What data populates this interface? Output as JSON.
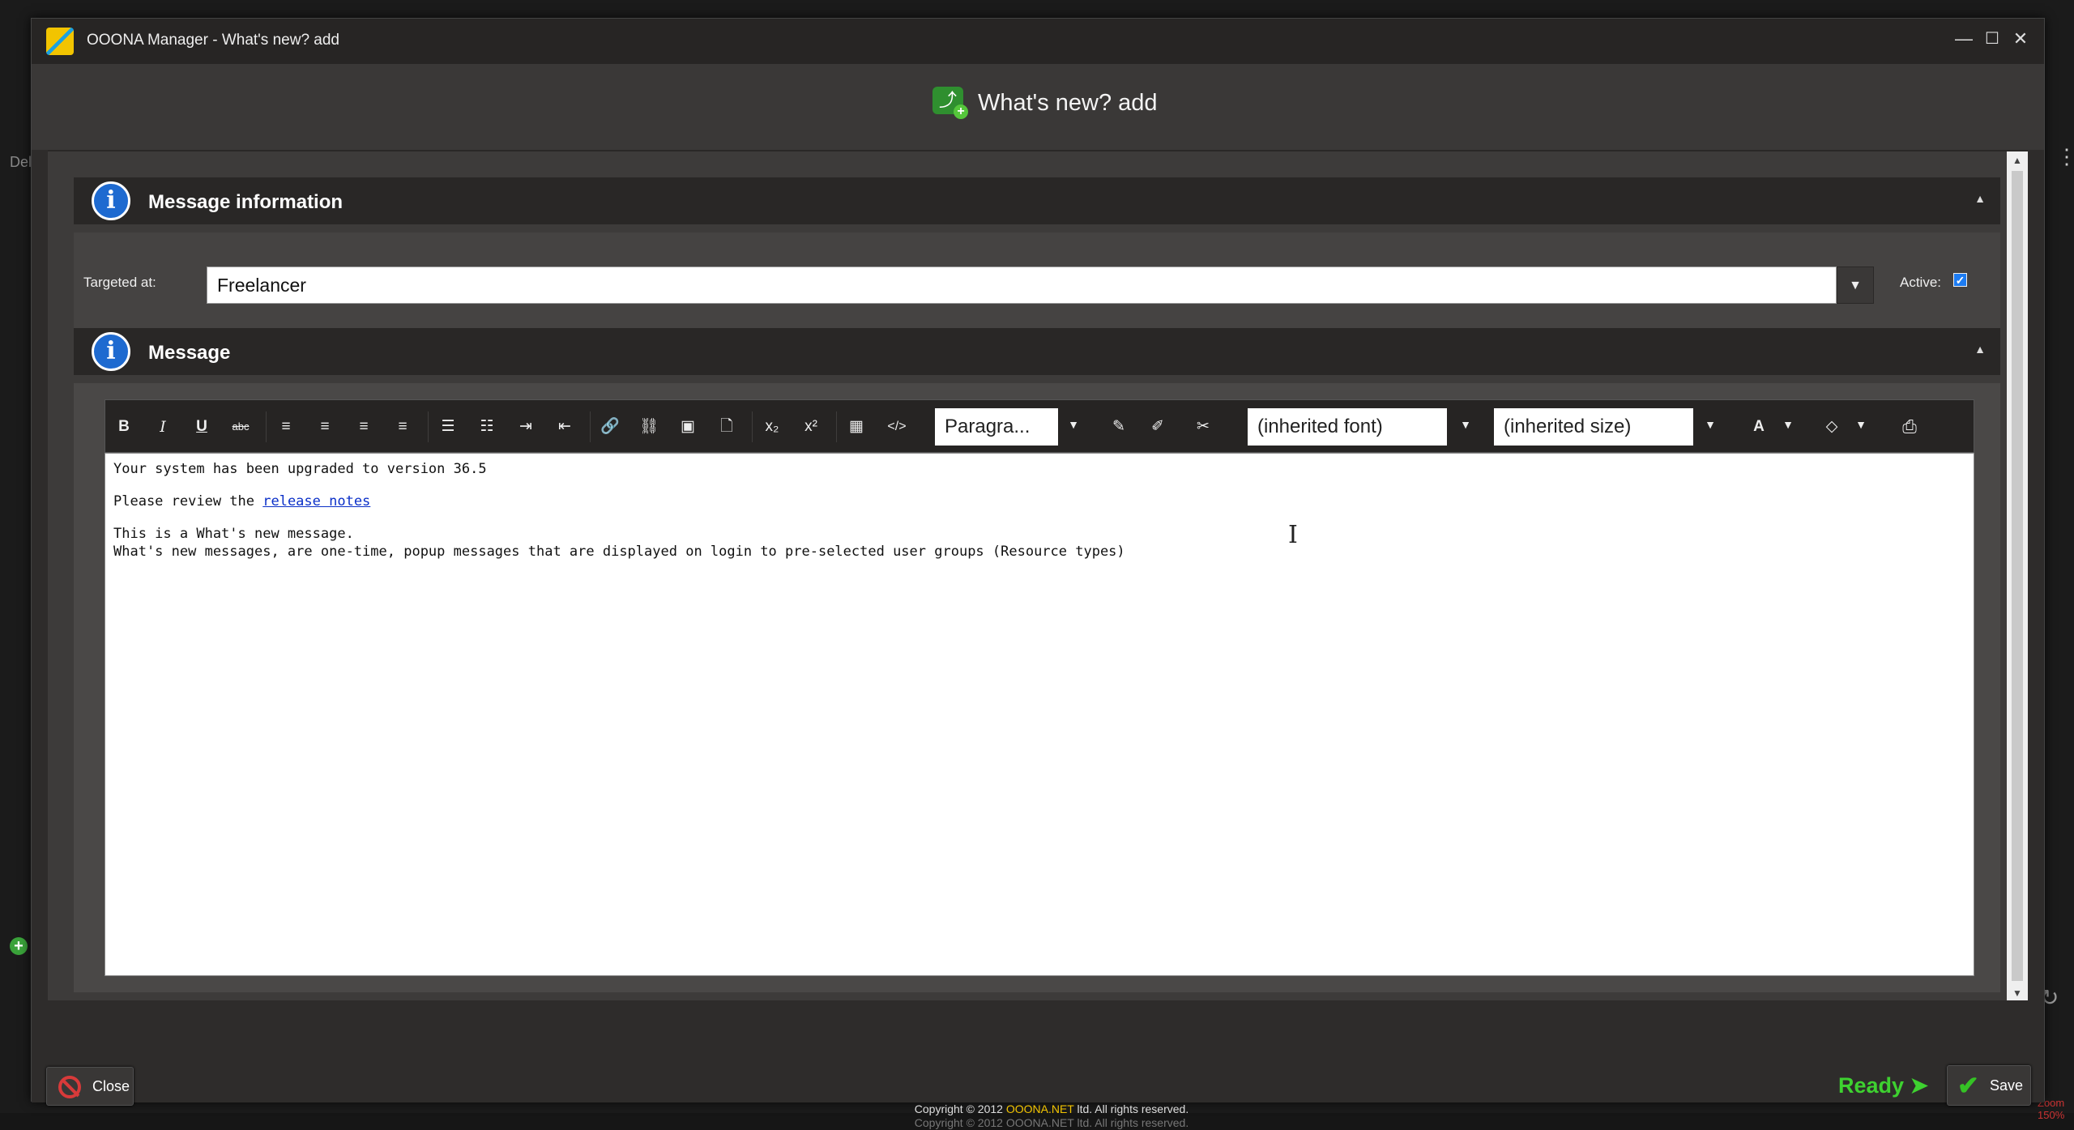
{
  "window": {
    "title": "OOONA Manager - What's new? add",
    "minimize_glyph": "—",
    "maximize_glyph": "☐",
    "close_glyph": "✕"
  },
  "background": {
    "left_label": "Del"
  },
  "header": {
    "title": "What's new? add",
    "icon": "share-add-icon"
  },
  "sections": {
    "message_info": {
      "title": "Message information",
      "icon": "info-icon"
    },
    "message": {
      "title": "Message",
      "icon": "info-icon"
    }
  },
  "form": {
    "targeted_label": "Targeted at:",
    "targeted_value": "Freelancer",
    "active_label": "Active:",
    "active_checked": true
  },
  "toolbar": {
    "buttons": [
      {
        "name": "bold-button",
        "glyph": "B"
      },
      {
        "name": "italic-button",
        "glyph": "I"
      },
      {
        "name": "underline-button",
        "glyph": "U"
      },
      {
        "name": "strikethrough-button",
        "glyph": "abc"
      },
      {
        "name": "align-left-button",
        "glyph": "≡"
      },
      {
        "name": "align-center-button",
        "glyph": "≡"
      },
      {
        "name": "align-right-button",
        "glyph": "≡"
      },
      {
        "name": "align-justify-button",
        "glyph": "≡"
      },
      {
        "name": "bullet-list-button",
        "glyph": "☰"
      },
      {
        "name": "numbered-list-button",
        "glyph": "☷"
      },
      {
        "name": "indent-button",
        "glyph": "⇥"
      },
      {
        "name": "outdent-button",
        "glyph": "⇤"
      },
      {
        "name": "insert-link-button",
        "glyph": "🔗"
      },
      {
        "name": "remove-link-button",
        "glyph": "⛓"
      },
      {
        "name": "insert-image-button",
        "glyph": "▣"
      },
      {
        "name": "insert-file-button",
        "glyph": "🗋"
      },
      {
        "name": "subscript-button",
        "glyph": "x₂"
      },
      {
        "name": "superscript-button",
        "glyph": "x²"
      },
      {
        "name": "insert-table-button",
        "glyph": "▦"
      },
      {
        "name": "view-html-button",
        "glyph": "</>"
      }
    ],
    "format_select": "Paragra...",
    "clean_buttons": [
      {
        "name": "clean-format-icon",
        "glyph": "✎"
      },
      {
        "name": "clear-css-icon",
        "glyph": "✐"
      },
      {
        "name": "clear-all-icon",
        "glyph": "✂"
      }
    ],
    "font_select": "(inherited font)",
    "size_select": "(inherited size)",
    "font_color_glyph": "A",
    "bg_color_glyph": "◇",
    "print_glyph": "⎙"
  },
  "editor": {
    "line1": "Your system has been upgraded to version 36.5",
    "line2_prefix": "Please review the ",
    "line2_link": "release notes",
    "line3": "This is a What's new message.",
    "line4": "What's new messages, are one-time, popup messages that are displayed on login to pre-selected user groups (Resource types)"
  },
  "footer": {
    "close_label": "Close",
    "ready_label": "Ready ➤",
    "save_label": "Save",
    "copyright_prefix": "Copyright © 2012 ",
    "copyright_brand": "OOONA.NET",
    "copyright_suffix": " ltd. All rights reserved.",
    "zoom_text": "Zoom 150%"
  },
  "colors": {
    "accent_green": "#3ed130",
    "info_blue": "#1e6ad0",
    "close_red": "#d83a3a",
    "brand_yellow": "#f2c400"
  }
}
